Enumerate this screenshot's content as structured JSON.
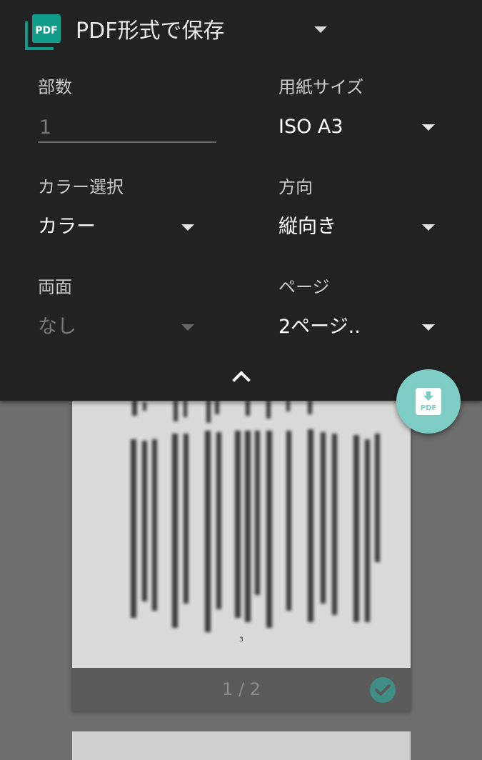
{
  "printer": {
    "name": "PDF形式で保存",
    "logo_icon": "pdf-logo-icon",
    "logo_text": "PDF",
    "accent_color": "#0f9d8a"
  },
  "settings": {
    "copies": {
      "label": "部数",
      "placeholder": "1"
    },
    "paper_size": {
      "label": "用紙サイズ",
      "value": "ISO A3"
    },
    "color_mode": {
      "label": "カラー選択",
      "value": "カラー"
    },
    "orientation": {
      "label": "方向",
      "value": "縦向き"
    },
    "duplex": {
      "label": "両面",
      "value": "なし"
    },
    "pages": {
      "label": "ページ",
      "value": "2ページ.."
    }
  },
  "fab": {
    "icon": "pdf-download-icon",
    "text": "PDF",
    "color": "#7ecdc4"
  },
  "preview": {
    "page_counter": "1 / 2",
    "page_number": "3",
    "selected": true
  }
}
